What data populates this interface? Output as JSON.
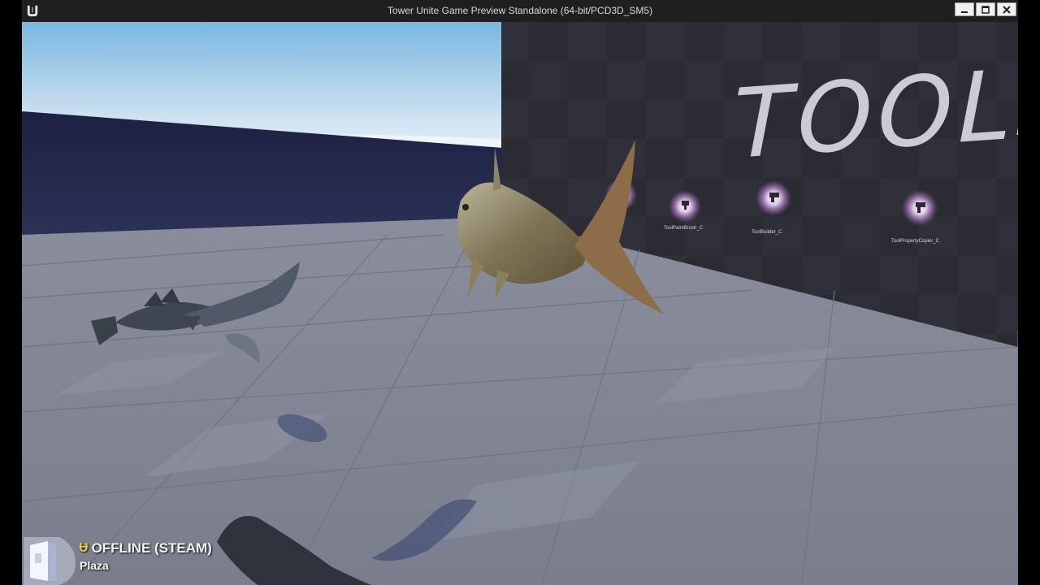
{
  "window": {
    "title": "Tower Unite Game Preview Standalone (64-bit/PCD3D_SM5)",
    "controls": [
      "minimize",
      "maximize",
      "close"
    ]
  },
  "scene": {
    "sign_text": "TOOLS",
    "pickups": [
      {
        "label": "ToolPaintBrush_C",
        "icon": "paint-brush-icon"
      },
      {
        "label": "ToolBuilder_C",
        "icon": "builder-icon"
      },
      {
        "label": "ToolPropertyCopier_C",
        "icon": "property-copier-icon"
      }
    ],
    "colors": {
      "sky_top": "#7ab6e0",
      "sky_bottom": "#dbe9f4",
      "floor": "#7c808e",
      "floor_light": "#8e93a1",
      "wall": "#23284a",
      "pickup_glow": "#f4d8ff"
    }
  },
  "hud": {
    "status_icon": "u-coin-icon",
    "status": "OFFLINE (STEAM)",
    "location": "Plaza"
  }
}
